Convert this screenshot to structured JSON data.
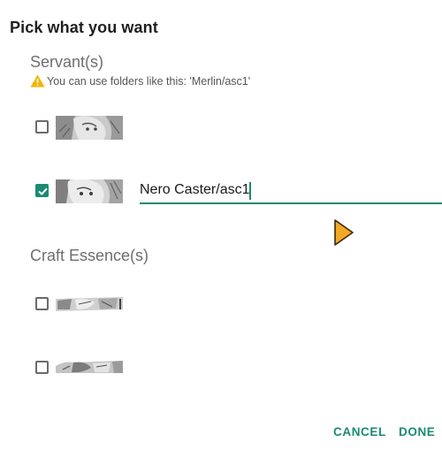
{
  "dialog": {
    "title": "Pick what you want",
    "servants_heading": "Servant(s)",
    "warning_text": "You can use folders like this: 'Merlin/asc1'",
    "craft_essences_heading": "Craft Essence(s)"
  },
  "servants": [
    {
      "checked": false
    },
    {
      "checked": true,
      "folder_value": "Nero Caster/asc1"
    }
  ],
  "craft_essences": [
    {
      "checked": false
    },
    {
      "checked": false
    }
  ],
  "actions": {
    "cancel_label": "CANCEL",
    "done_label": "DONE"
  },
  "colors": {
    "accent": "#1b8a73",
    "warning": "#f4b400"
  },
  "icons": {
    "warning": "warning-triangle-icon",
    "checkbox_checked": "checkmark-icon",
    "pointer": "mouse-pointer-icon"
  }
}
